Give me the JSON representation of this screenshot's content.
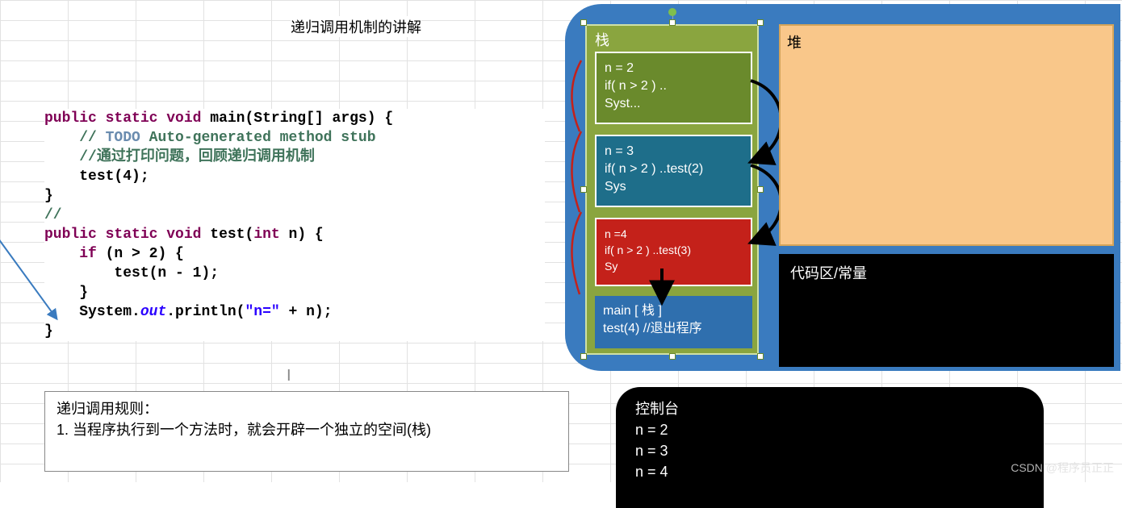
{
  "title": "递归调用机制的讲解",
  "code": {
    "l1a": "public",
    "l1b": "static",
    "l1c": "void",
    "l1d": "main",
    "l1e": "(String[] args) {",
    "l2a": "// ",
    "l2b": "TODO",
    "l2c": " Auto-generated method stub",
    "l3": "//通过打印问题，回顾递归调用机制",
    "l4": "test(4);",
    "l5": "}",
    "l6": "//",
    "l7a": "public",
    "l7b": "static",
    "l7c": "void",
    "l7d": "test",
    "l7e": "(",
    "l7f": "int",
    "l7g": " n) {",
    "l8a": "if",
    "l8b": " (n > 2) {",
    "l9": "test(n - 1);",
    "l10": "}",
    "l11a": "System.",
    "l11b": "out",
    "l11c": ".println(",
    "l11d": "\"n=\"",
    "l11e": " + n);",
    "l12": "}"
  },
  "rules": {
    "header": "递归调用规则：",
    "item1": "1. 当程序执行到一个方法时，就会开辟一个独立的空间(栈)"
  },
  "stack": {
    "title": "栈",
    "f2": {
      "l1": "n = 2",
      "l2": "if( n > 2 ) ..",
      "l3": "Syst..."
    },
    "f3": {
      "l1": "n = 3",
      "l2": "if( n > 2 ) ..test(2)",
      "l3": "Sys"
    },
    "f4": {
      "l1": "n =4",
      "l2": "if( n > 2 ) ..test(3)",
      "l3": "Sy"
    },
    "main": {
      "l1": "main [ 栈 ]",
      "l2": "test(4) //退出程序"
    }
  },
  "heap": {
    "title": "堆"
  },
  "codearea": {
    "title": "代码区/常量"
  },
  "console": {
    "title": "控制台",
    "lines": [
      "n = 2",
      "n = 3",
      "n = 4"
    ]
  },
  "watermark": "CSDN @程序员正正"
}
